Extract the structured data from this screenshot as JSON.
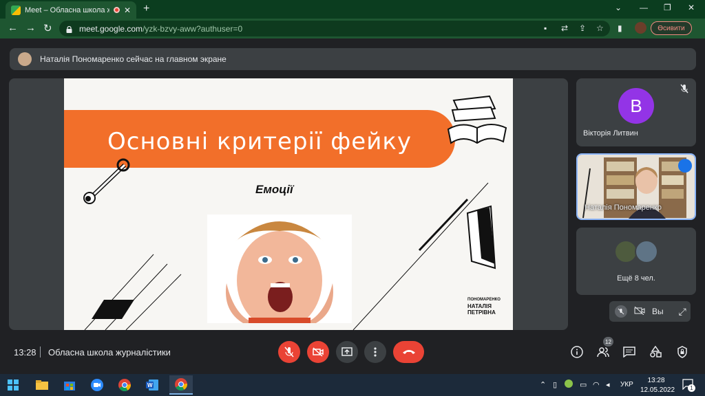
{
  "browser": {
    "tab_title": "Meet – Обласна школа журналістики",
    "url_host": "meet.google.com",
    "url_path": "/yzk-bzvy-aww?authuser=0",
    "sync_label": "Өсивити"
  },
  "meet": {
    "banner_text": "Наталія Пономаренко сейчас на главном экране",
    "slide": {
      "title": "Основні критерії фейку",
      "subtitle": "Емоції",
      "brand_line1": "ПОНОМАРЕНКО",
      "brand_line2": "НАТАЛІЯ",
      "brand_line3": "ПЕТРІВНА"
    },
    "participants": [
      {
        "initial": "В",
        "name": "Вікторія Литвин"
      },
      {
        "name": "Наталія Пономаренко"
      }
    ],
    "more_label": "Ещё 8 чел.",
    "self_label": "Вы",
    "clock": "13:28",
    "meeting_name": "Обласна школа журналістики",
    "participants_count": "12"
  },
  "taskbar": {
    "lang": "УКР",
    "time": "13:28",
    "date": "12.05.2022",
    "notif_count": "1"
  },
  "colors": {
    "accent_green": "#1e5631",
    "slide_orange": "#f26f2a",
    "end_call_red": "#ea4335",
    "avatar_purple": "#9334e6"
  }
}
